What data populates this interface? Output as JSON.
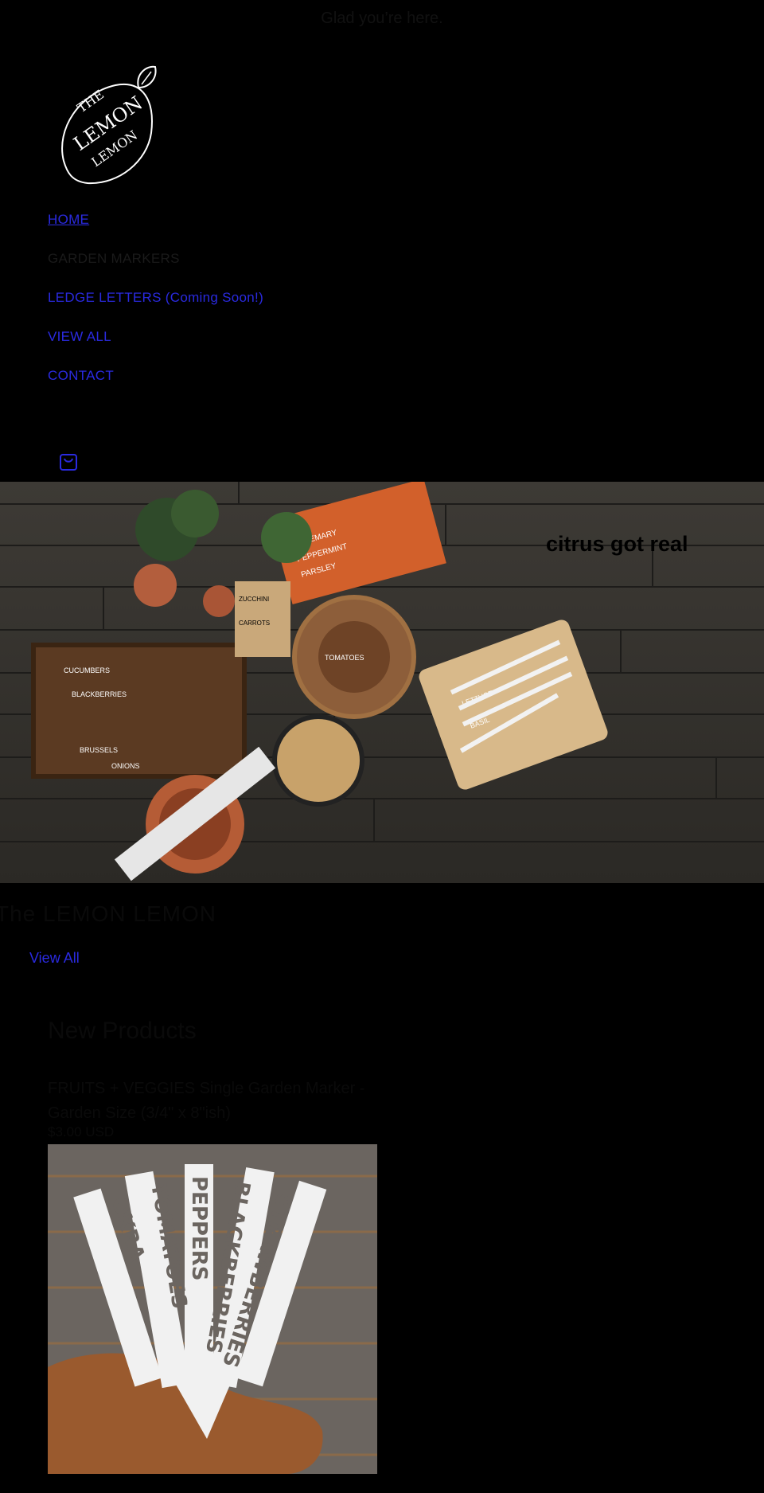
{
  "announcement": "Glad you’re here.",
  "logo": {
    "name": "THE LEMON LEMON",
    "icon": "lemon-logo-icon"
  },
  "nav": {
    "items": [
      {
        "label": "HOME",
        "current": true
      },
      {
        "label": "GARDEN MARKERS",
        "current": false
      },
      {
        "label": "LEDGE LETTERS (Coming Soon!)",
        "current": false
      },
      {
        "label": "VIEW ALL",
        "current": false
      },
      {
        "label": "CONTACT",
        "current": false
      }
    ]
  },
  "cart": {
    "icon": "shopping-bag-icon"
  },
  "hero": {
    "caption": "citrus got real",
    "marker_words": [
      "ROSEMARY",
      "PEPPERMINT",
      "PARSLEY",
      "BASIL",
      "TOMATOES",
      "CUCUMBERS",
      "ZUCCHINI",
      "BRUSSELS",
      "ONIONS",
      "BLACKBERRIES",
      "CARROTS",
      "LETTUCE"
    ]
  },
  "collection": {
    "title": "The LEMON LEMON",
    "view_all": "View All"
  },
  "new_products": {
    "title": "New Products",
    "products": [
      {
        "title": "FRUITS + VEGGIES Single Garden Marker - Garden Size (3/4\" x 8\"ish)",
        "price": "$3.00 USD",
        "image_words": [
          "OKRA",
          "TOMATOES",
          "PEPPERS",
          "BLACKBERRIES",
          "STRAWBERRIES"
        ]
      }
    ]
  },
  "colors": {
    "background": "#000000",
    "link": "#2a2ae0",
    "text": "#111111"
  }
}
